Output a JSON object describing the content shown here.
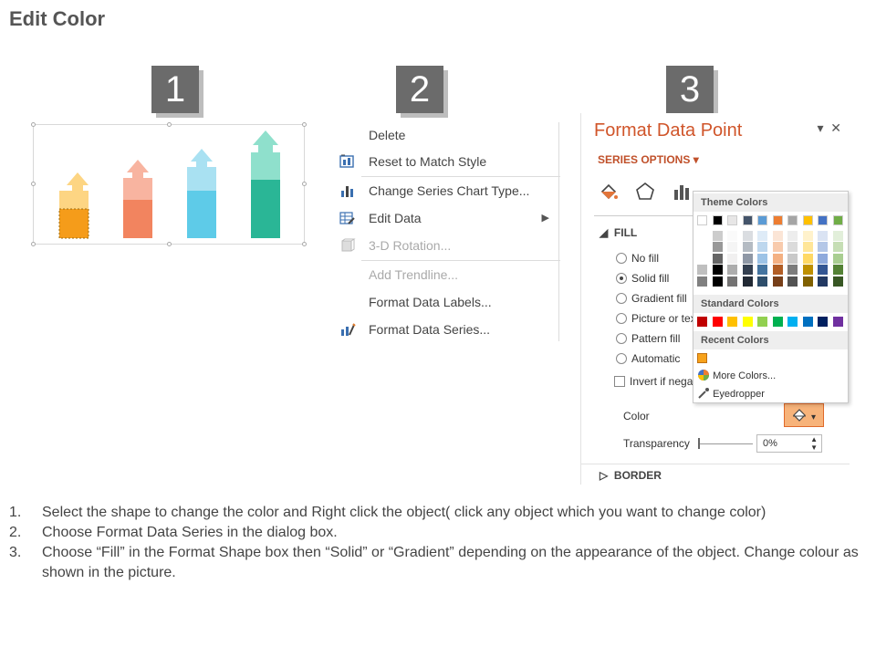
{
  "header": {
    "title": "Edit Color"
  },
  "steps_badges": [
    "1",
    "2",
    "3"
  ],
  "context_menu": {
    "items": [
      {
        "label": "Delete",
        "icon": "none",
        "disabled": false
      },
      {
        "label": "Reset to Match Style",
        "icon": "reset-style-icon",
        "disabled": false
      },
      {
        "label": "Change Series Chart Type...",
        "icon": "chart-type-icon",
        "disabled": false
      },
      {
        "label": "Edit Data",
        "icon": "edit-data-icon",
        "disabled": false,
        "submenu": true
      },
      {
        "label": "3-D Rotation...",
        "icon": "rotation-icon",
        "disabled": true
      },
      {
        "label": "Add Trendline...",
        "icon": "none",
        "disabled": true
      },
      {
        "label": "Format Data Labels...",
        "icon": "none",
        "disabled": false
      },
      {
        "label": "Format Data Series...",
        "icon": "format-series-icon",
        "disabled": false
      }
    ]
  },
  "format_pane": {
    "title": "Format Data Point",
    "series_options": "SERIES OPTIONS",
    "fill_section": "FILL",
    "fill_options": [
      "No fill",
      "Solid fill",
      "Gradient fill",
      "Picture or tex",
      "Pattern fill",
      "Automatic"
    ],
    "selected_fill": "Solid fill",
    "invert_label": "Invert if nega",
    "color_label": "Color",
    "transparency_label": "Transparency",
    "transparency_value": "0%",
    "border_section": "BORDER"
  },
  "color_picker": {
    "theme_label": "Theme Colors",
    "standard_label": "Standard Colors",
    "recent_label": "Recent Colors",
    "more_colors": "More Colors...",
    "eyedropper": "Eyedropper",
    "theme_top": [
      "#ffffff",
      "#000000",
      "#e7e6e6",
      "#44546a",
      "#5b9bd5",
      "#ed7d31",
      "#a5a5a5",
      "#ffc000",
      "#4472c4",
      "#70ad47"
    ],
    "standard": [
      "#c00000",
      "#ff0000",
      "#ffc000",
      "#ffff00",
      "#92d050",
      "#00b050",
      "#00b0f0",
      "#0070c0",
      "#002060",
      "#7030a0"
    ],
    "recent": [
      "#f7a21b"
    ]
  },
  "chart": {
    "bars": [
      {
        "top_color": "#fdd583",
        "bottom_color": "#f59c1a",
        "arrow_color": "#fdd583"
      },
      {
        "top_color": "#f8b4a0",
        "bottom_color": "#f2845f",
        "arrow_color": "#f8b4a0"
      },
      {
        "top_color": "#a9e1f2",
        "bottom_color": "#5ecbe8",
        "arrow_color": "#a9e1f2"
      },
      {
        "top_color": "#8fe0cc",
        "bottom_color": "#2ab696",
        "arrow_color": "#8fe0cc"
      }
    ]
  },
  "instructions": [
    {
      "num": "1.",
      "text": "Select the shape to change the color and Right click the object( click any object which you want to change color)"
    },
    {
      "num": "2.",
      "text": "Choose Format Data Series in the dialog box."
    },
    {
      "num": "3.",
      "text": "Choose “Fill” in the Format Shape box then  “Solid” or “Gradient” depending on the appearance of the object. Change colour as shown in the picture."
    }
  ]
}
